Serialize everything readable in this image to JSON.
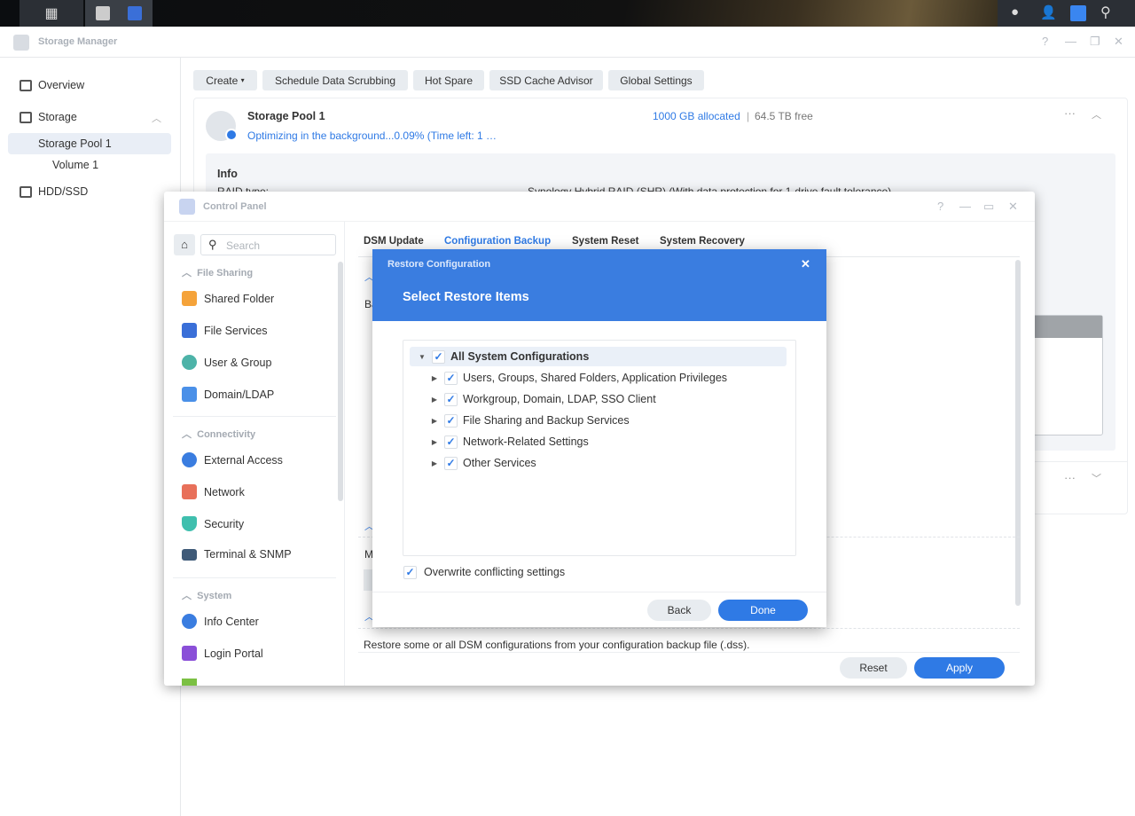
{
  "taskbar": {
    "left_icons": [
      "main-menu-icon",
      "storage-manager-icon",
      "control-panel-icon"
    ],
    "right_icons": [
      "chat-icon",
      "user-icon",
      "widgets-icon",
      "search-icon"
    ]
  },
  "storage_manager": {
    "title": "Storage Manager",
    "sidebar": [
      {
        "label": "Overview"
      },
      {
        "label": "Storage"
      },
      {
        "label": "Storage Pool 1"
      },
      {
        "label": "Volume 1"
      },
      {
        "label": "HDD/SSD"
      }
    ],
    "toolbar": [
      "Create",
      "Schedule Data Scrubbing",
      "Hot Spare",
      "SSD Cache Advisor",
      "Global Settings"
    ],
    "pool": {
      "name": "Storage Pool 1",
      "status": "Optimizing in the background...0.09% (Time left: 1 …",
      "allocated": "1000 GB allocated",
      "separator": "|",
      "free": "64.5 TB free",
      "info_title": "Info",
      "raid_label": "RAID type:",
      "raid_value": "Synology Hybrid RAID (SHR) (With data protection for 1-drive fault tolerance)"
    }
  },
  "control_panel": {
    "title": "Control Panel",
    "search_placeholder": "Search",
    "groups": [
      {
        "label": "File Sharing",
        "items": [
          "Shared Folder",
          "File Services",
          "User & Group",
          "Domain/LDAP"
        ]
      },
      {
        "label": "Connectivity",
        "items": [
          "External Access",
          "Network",
          "Security",
          "Terminal & SNMP"
        ]
      },
      {
        "label": "System",
        "items": [
          "Info Center",
          "Login Portal"
        ]
      }
    ],
    "tabs": [
      "DSM Update",
      "Configuration Backup",
      "System Reset",
      "System Recovery"
    ],
    "active_tab": "Configuration Backup",
    "partial_labels": [
      "Ba",
      "M"
    ],
    "description": "Restore some or all DSM configurations from your configuration backup file (.dss).",
    "reset_label": "Reset",
    "apply_label": "Apply"
  },
  "modal": {
    "title": "Restore Configuration",
    "heading": "Select Restore Items",
    "root": {
      "label": "All System Configurations",
      "checked": true,
      "expanded": true
    },
    "children": [
      {
        "label": "Users, Groups, Shared Folders, Application Privileges",
        "checked": true
      },
      {
        "label": "Workgroup, Domain, LDAP, SSO Client",
        "checked": true
      },
      {
        "label": "File Sharing and Backup Services",
        "checked": true
      },
      {
        "label": "Network-Related Settings",
        "checked": true
      },
      {
        "label": "Other Services",
        "checked": true
      }
    ],
    "overwrite": {
      "label": "Overwrite conflicting settings",
      "checked": true
    },
    "back_label": "Back",
    "done_label": "Done"
  },
  "colors": {
    "accent": "#2f7ae5",
    "modal_header": "#3a7de0"
  }
}
